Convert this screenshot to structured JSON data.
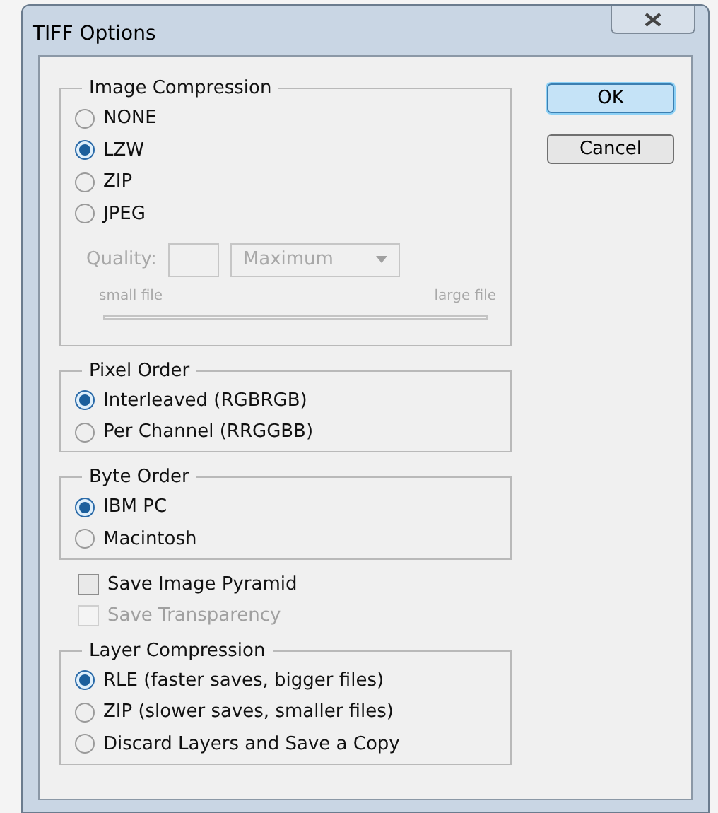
{
  "window": {
    "title": "TIFF Options"
  },
  "image_compression": {
    "legend": "Image Compression",
    "options": [
      {
        "label": "NONE",
        "selected": false
      },
      {
        "label": "LZW",
        "selected": true
      },
      {
        "label": "ZIP",
        "selected": false
      },
      {
        "label": "JPEG",
        "selected": false
      }
    ],
    "quality": {
      "label": "Quality:",
      "preset": "Maximum",
      "disabled": true,
      "small_label": "small file",
      "large_label": "large file"
    }
  },
  "pixel_order": {
    "legend": "Pixel Order",
    "options": [
      {
        "label": "Interleaved (RGBRGB)",
        "selected": true
      },
      {
        "label": "Per Channel (RRGGBB)",
        "selected": false
      }
    ]
  },
  "byte_order": {
    "legend": "Byte Order",
    "options": [
      {
        "label": "IBM PC",
        "selected": true
      },
      {
        "label": "Macintosh",
        "selected": false
      }
    ]
  },
  "checkboxes": [
    {
      "label": "Save Image Pyramid",
      "checked": false,
      "disabled": false
    },
    {
      "label": "Save Transparency",
      "checked": false,
      "disabled": true
    }
  ],
  "layer_compression": {
    "legend": "Layer Compression",
    "options": [
      {
        "label": "RLE (faster saves, bigger files)",
        "selected": true
      },
      {
        "label": "ZIP (slower saves, smaller files)",
        "selected": false
      },
      {
        "label": "Discard Layers and Save a Copy",
        "selected": false
      }
    ]
  },
  "buttons": [
    {
      "label": "OK",
      "default": true
    },
    {
      "label": "Cancel",
      "default": false
    }
  ]
}
